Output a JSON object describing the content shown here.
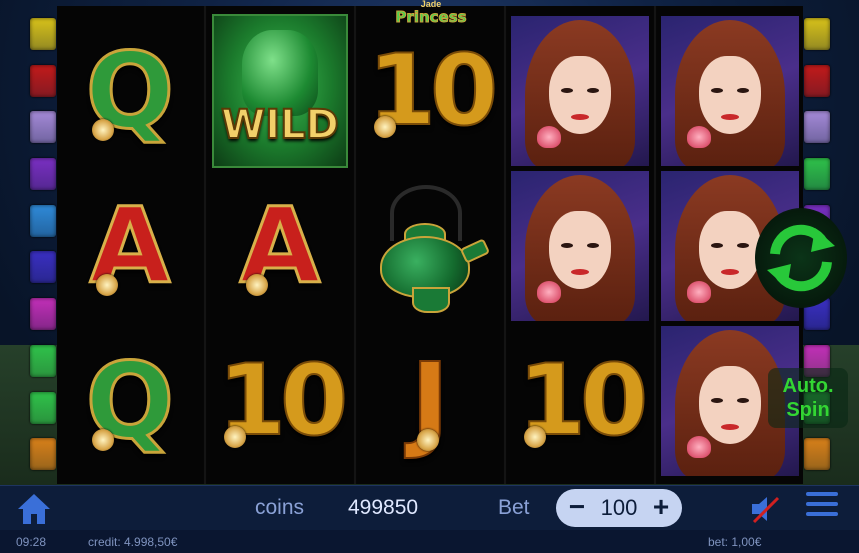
{
  "game": {
    "logo_top": "Jade",
    "logo_main": "Princess"
  },
  "reels": [
    [
      "Q",
      "A",
      "Q"
    ],
    [
      "WILD",
      "A",
      "10"
    ],
    [
      "10",
      "teapot",
      "J"
    ],
    [
      "princess",
      "princess",
      "10"
    ],
    [
      "princess",
      "princess",
      "princess"
    ]
  ],
  "symbols": {
    "wild_label": "WILD"
  },
  "controls": {
    "auto_spin_line1": "Auto.",
    "auto_spin_line2": "Spin",
    "coins_label": "coins",
    "coins_value": "499850",
    "bet_label": "Bet",
    "bet_minus": "−",
    "bet_value": "100",
    "bet_plus": "+"
  },
  "status": {
    "clock": "09:28",
    "credit": "credit: 4.998,50€",
    "bet": "bet: 1,00€"
  },
  "indicator_colors": {
    "left": [
      "#d8c21a",
      "#c21a1a",
      "#a58ad8",
      "#7a2fc2",
      "#2f8ad8",
      "#3a2fc2",
      "#c22fb8",
      "#2fc24a",
      "#2fc24a",
      "#d8801a"
    ],
    "right": [
      "#d8c21a",
      "#c21a1a",
      "#a58ad8",
      "#2fc24a",
      "#7a2fc2",
      "#2f8ad8",
      "#3a2fc2",
      "#c22fb8",
      "#2fc24a",
      "#d8801a"
    ]
  },
  "colors": {
    "spin_arrow": "#28c83a",
    "bottom_bar": "#0d1d3a",
    "accent_blue": "#3a6fd8"
  },
  "icons": [
    "home-icon",
    "spin-icon",
    "sound-muted-icon",
    "menu-icon"
  ]
}
